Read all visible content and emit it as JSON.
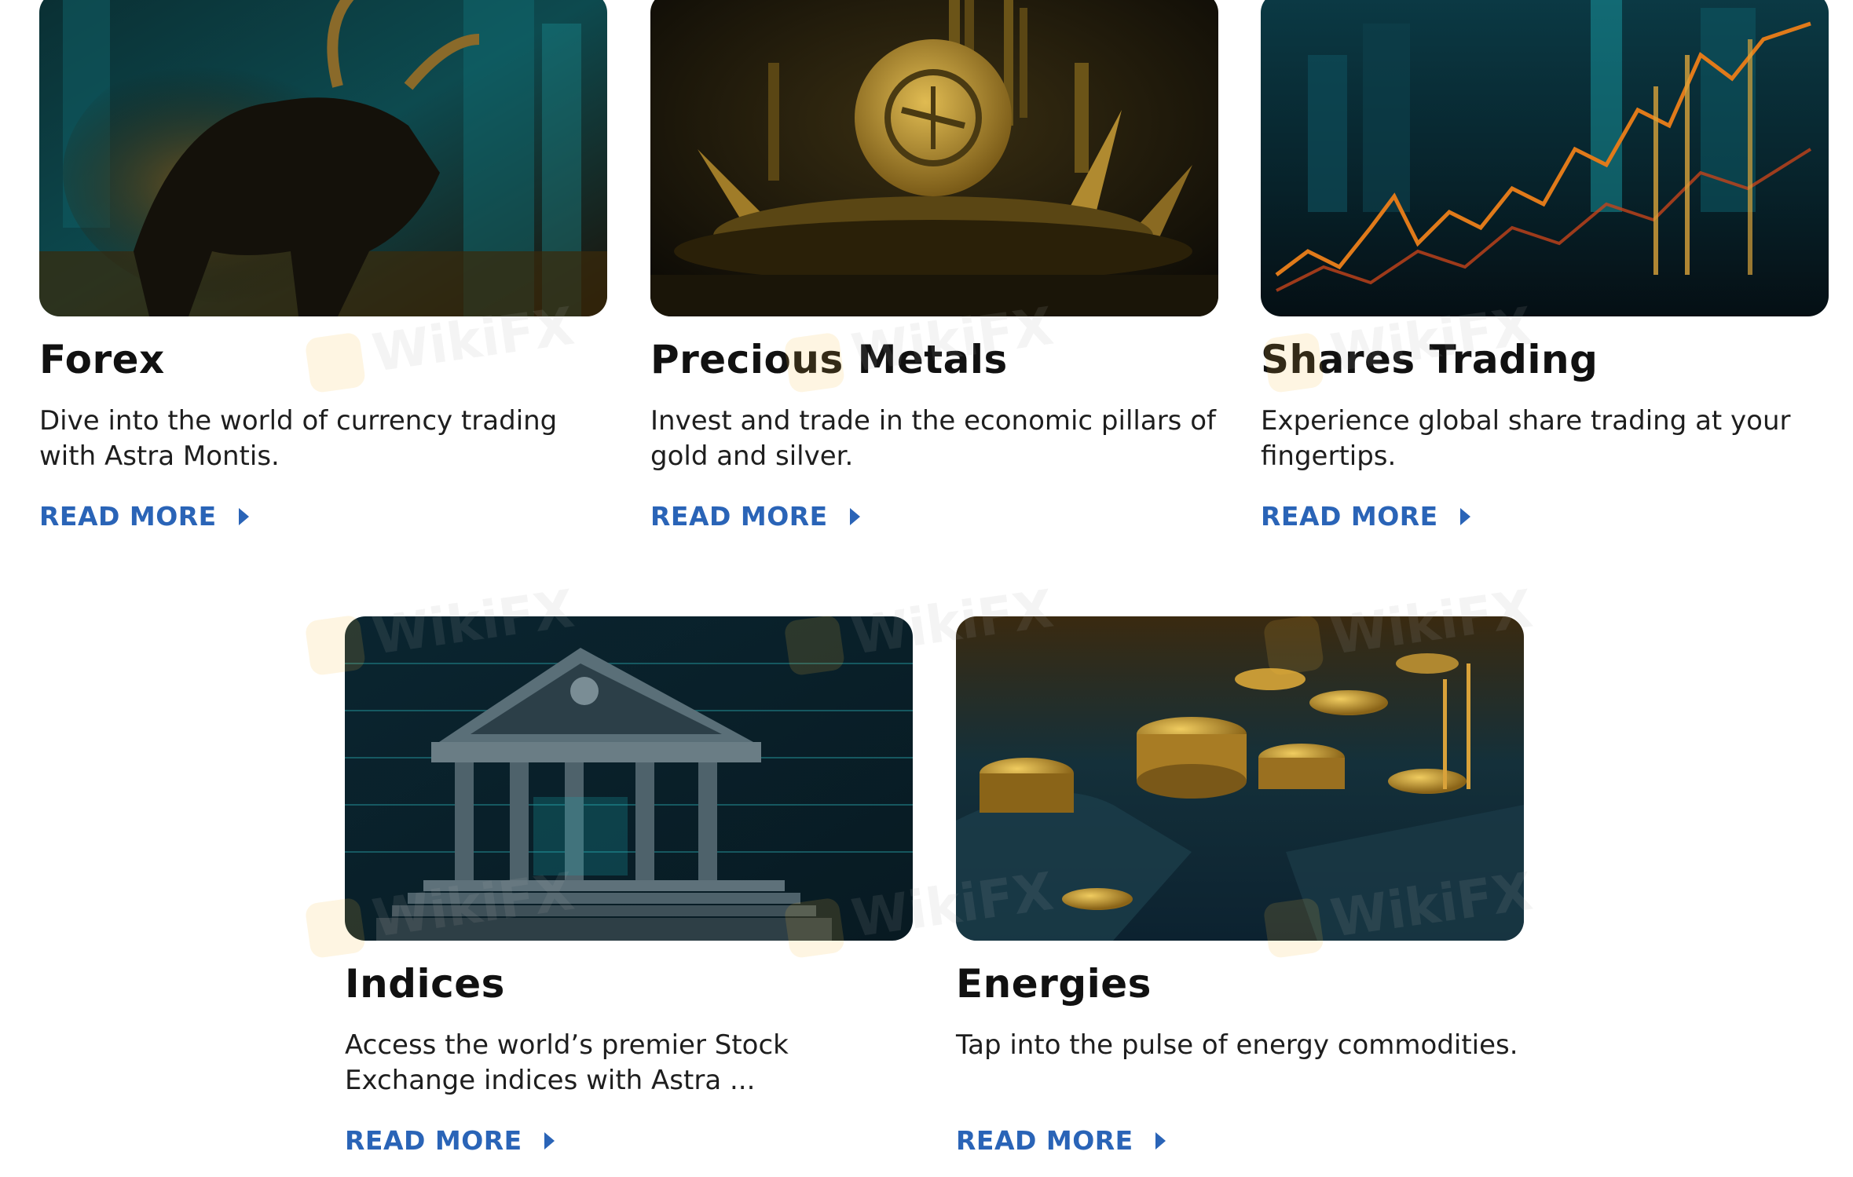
{
  "cards": [
    {
      "title": "Forex",
      "description": "Dive into the world of currency trading with Astra Montis.",
      "link": "READ MORE"
    },
    {
      "title": "Precious Metals",
      "description": "Invest and trade in the economic pillars of gold and silver.",
      "link": "READ MORE"
    },
    {
      "title": "Shares Trading",
      "description": "Experience global share trading at your fingertips.",
      "link": "READ MORE"
    },
    {
      "title": "Indices",
      "description": "Access the world’s premier Stock Exchange indices with Astra ...",
      "link": "READ MORE"
    },
    {
      "title": "Energies",
      "description": "Tap into the pulse of energy commodities.",
      "link": "READ MORE"
    }
  ],
  "watermark": "WikiFX",
  "colors": {
    "link": "#2a64b7",
    "title": "#111111",
    "text": "#1e1e1e"
  }
}
